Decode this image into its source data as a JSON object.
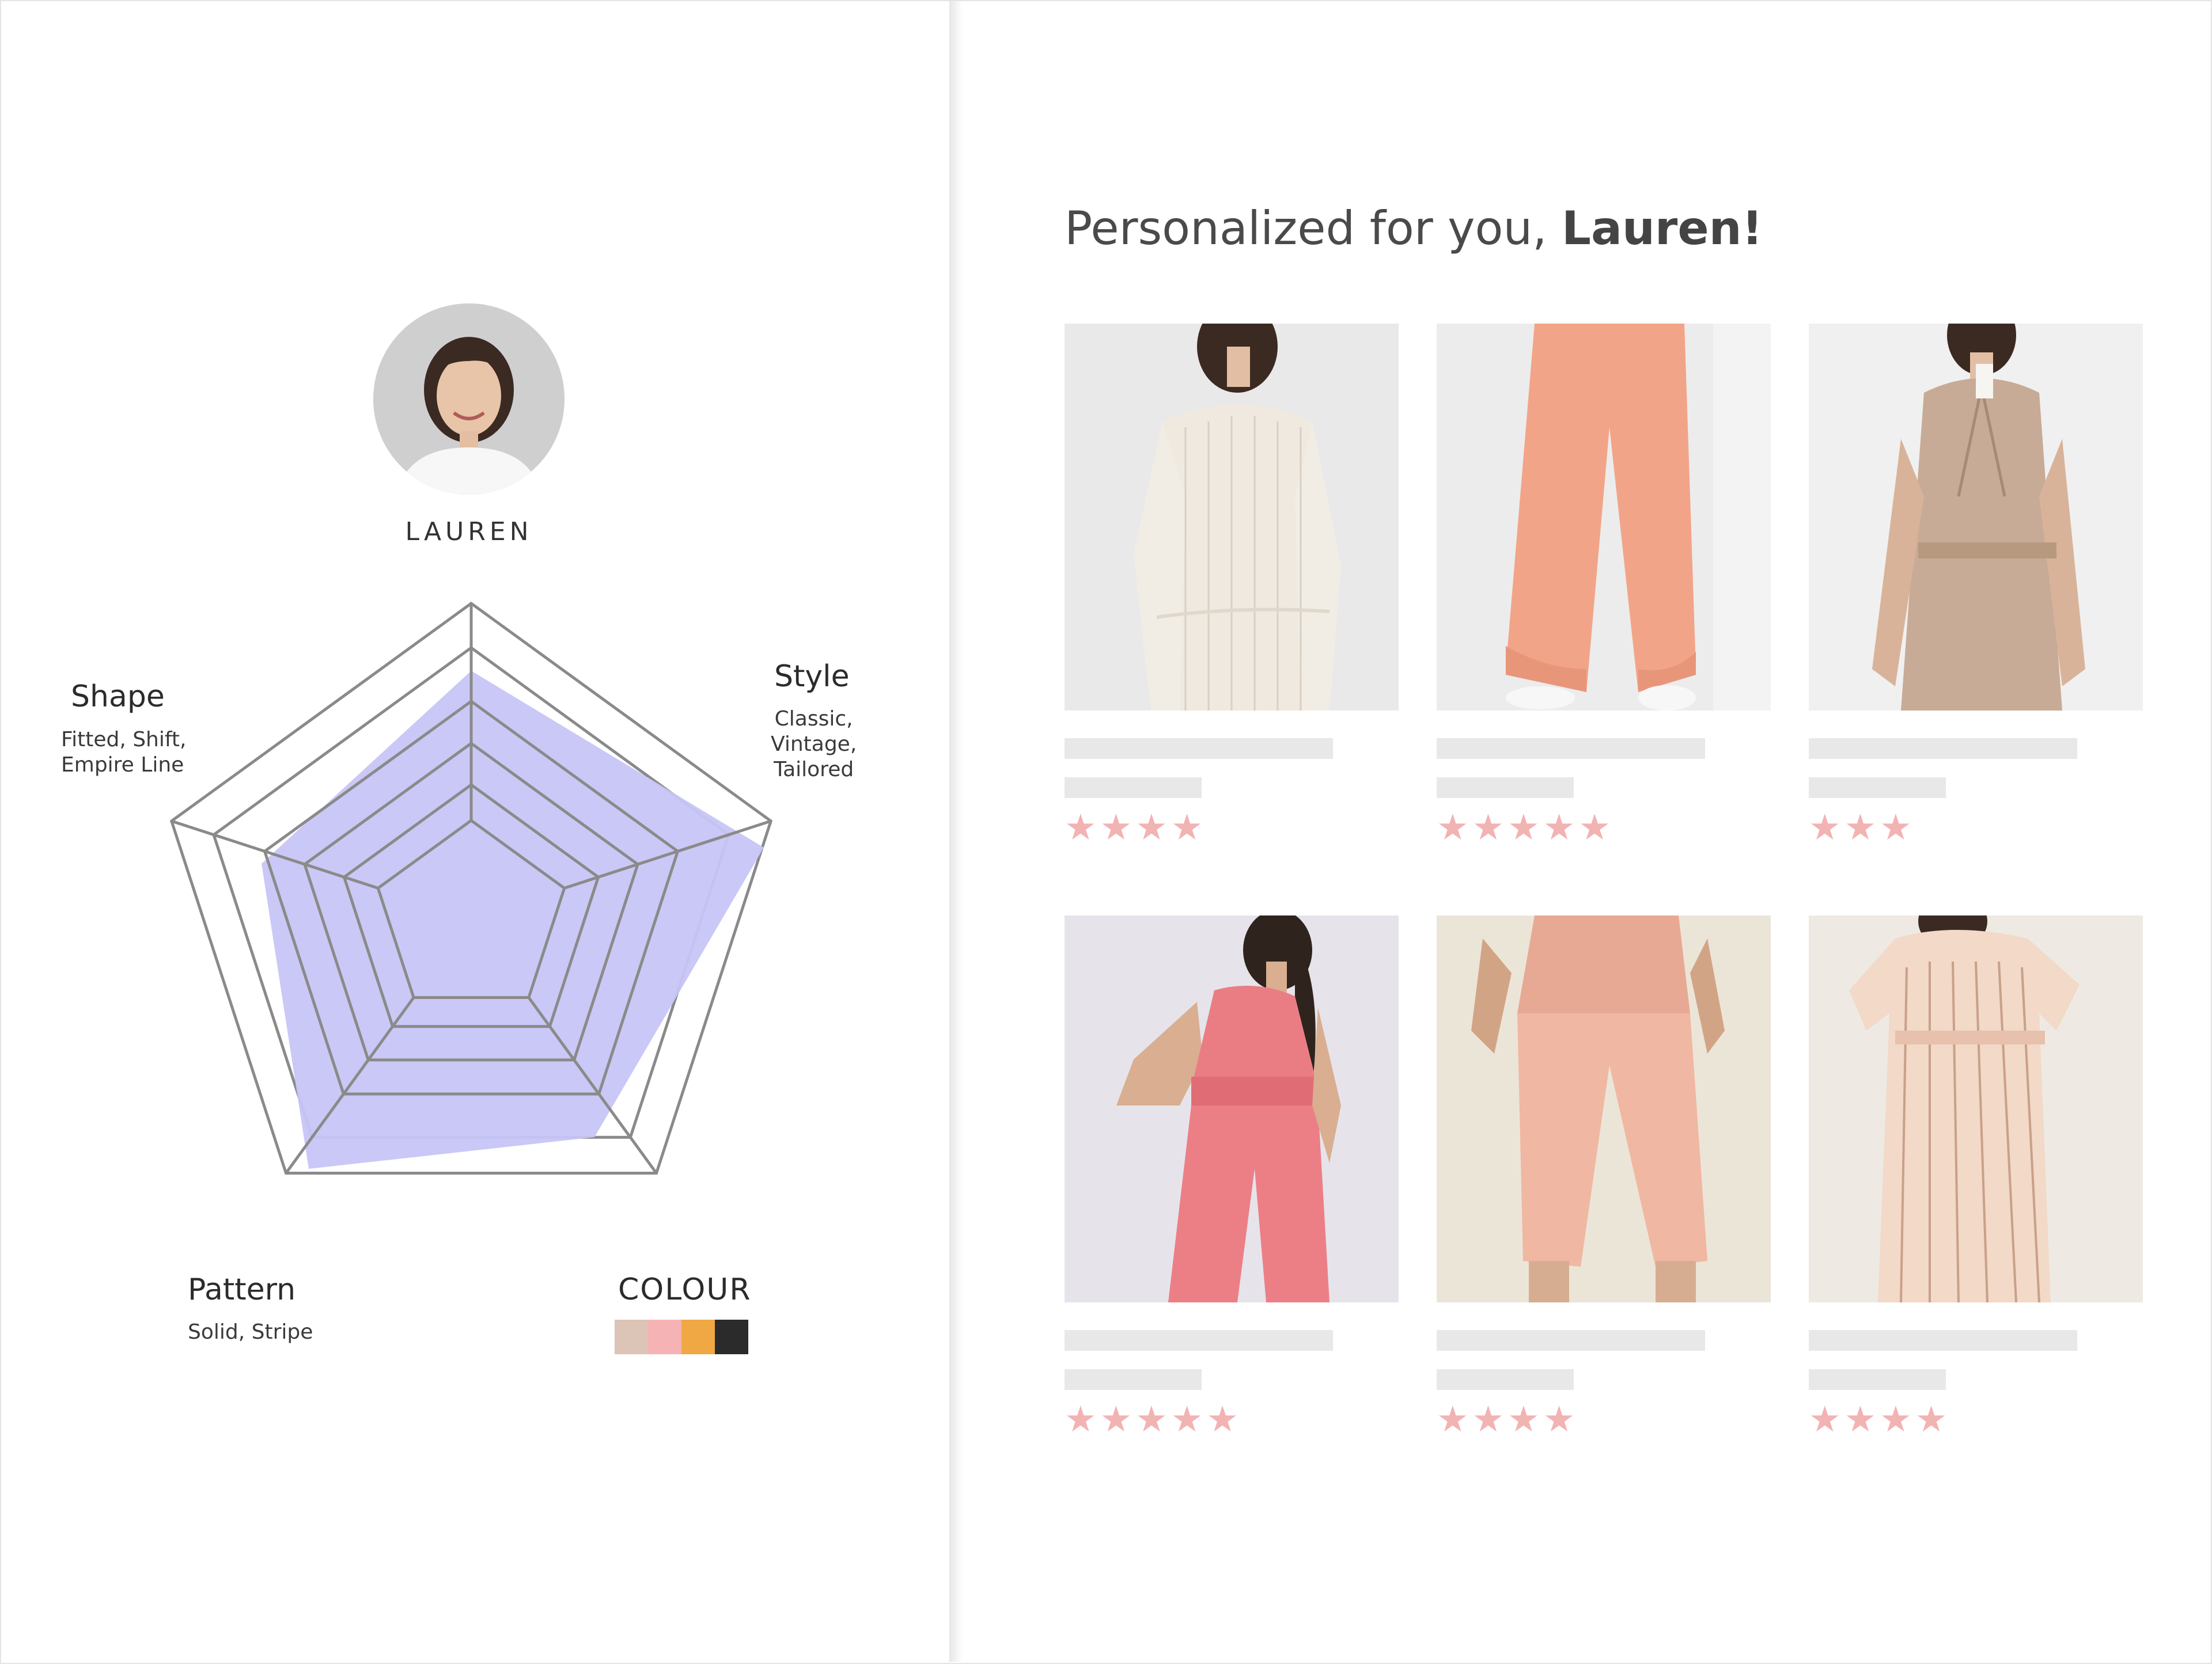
{
  "profile": {
    "name": "LAUREN",
    "axes": {
      "shape": {
        "title": "Shape",
        "detail": [
          "Fitted, Shift,",
          "Empire Line"
        ]
      },
      "style": {
        "title": "Style",
        "detail": [
          "Classic,",
          "Vintage,",
          "Tailored"
        ]
      },
      "pattern": {
        "title": "Pattern",
        "detail": [
          "Solid, Stripe"
        ]
      },
      "colour": {
        "title": "COLOUR"
      }
    },
    "swatches": [
      "#dcc4b6",
      "#f5b3b6",
      "#f0a844",
      "#2b2b2b"
    ],
    "radar_fill": "#c7c5f5"
  },
  "feed": {
    "heading_prefix": "Personalized for you, ",
    "heading_name": "Lauren!",
    "products": [
      {
        "image": "striped-cream-dress",
        "rating_text": "★★★★"
      },
      {
        "image": "coral-jogger-pants",
        "rating_text": "★★★★★"
      },
      {
        "image": "beige-belted-jumpsuit",
        "rating_text": "★★★"
      },
      {
        "image": "pink-sleeveless-jumpsuit",
        "rating_text": "★★★★★"
      },
      {
        "image": "blush-tapered-trousers",
        "rating_text": "★★★★"
      },
      {
        "image": "striped-wrap-dress",
        "rating_text": "★★★★"
      }
    ],
    "star_color": "#f2b3b3"
  }
}
